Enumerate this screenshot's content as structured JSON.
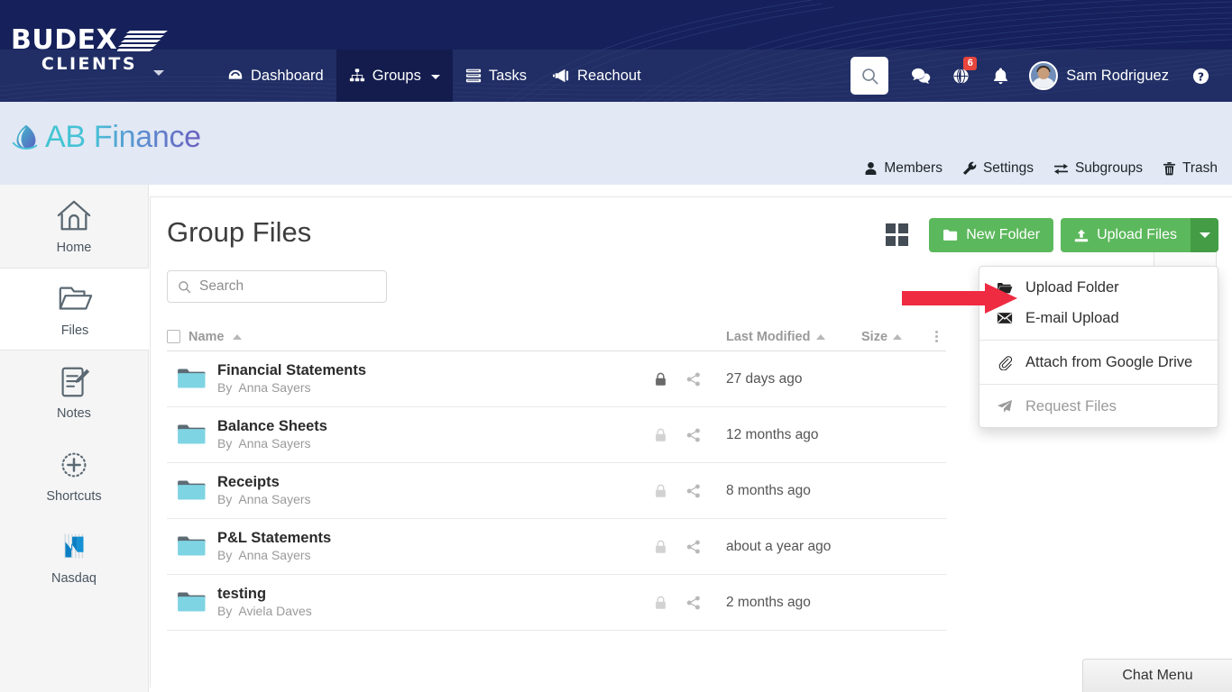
{
  "topnav": {
    "logo_primary": "BUDEX",
    "logo_secondary": "CLIENTS",
    "items": [
      {
        "label": "Dashboard",
        "icon": "dashboard-icon",
        "active": false,
        "caret": false
      },
      {
        "label": "Groups",
        "icon": "sitemap-icon",
        "active": true,
        "caret": true
      },
      {
        "label": "Tasks",
        "icon": "tasks-icon",
        "active": false,
        "caret": false
      },
      {
        "label": "Reachout",
        "icon": "bullhorn-icon",
        "active": false,
        "caret": false
      }
    ],
    "search_icon": "search-icon",
    "chat_icon": "comments-icon",
    "globe_icon": "globe-icon",
    "globe_badge": "6",
    "bell_icon": "bell-icon",
    "user_name": "Sam Rodriguez",
    "help_icon": "question-circle-icon"
  },
  "group_header": {
    "name": "AB Finance",
    "logo_icon": "ab-finance-logo-icon",
    "links": [
      {
        "label": "Members",
        "icon": "user-icon"
      },
      {
        "label": "Settings",
        "icon": "wrench-icon"
      },
      {
        "label": "Subgroups",
        "icon": "exchange-icon"
      },
      {
        "label": "Trash",
        "icon": "trash-icon"
      }
    ]
  },
  "sidebar": {
    "items": [
      {
        "label": "Home",
        "icon": "home-icon",
        "active": false
      },
      {
        "label": "Files",
        "icon": "folder-open-icon",
        "active": true
      },
      {
        "label": "Notes",
        "icon": "notes-pencil-icon",
        "active": false
      },
      {
        "label": "Shortcuts",
        "icon": "plus-circle-dashed-icon",
        "active": false
      },
      {
        "label": "Nasdaq",
        "icon": "nasdaq-icon",
        "active": false
      }
    ]
  },
  "main": {
    "title": "Group Files",
    "grid_view_icon": "grid-view-icon",
    "new_folder_label": "New Folder",
    "new_folder_icon": "folder-icon",
    "upload_files_label": "Upload Files",
    "upload_files_icon": "upload-icon",
    "upload_caret_icon": "caret-down-icon",
    "search": {
      "value": "",
      "placeholder": "Search",
      "icon": "search-icon"
    },
    "dropdown": {
      "items": [
        {
          "label": "Upload Folder",
          "icon": "folder-open-icon",
          "disabled": false,
          "highlighted": false
        },
        {
          "label": "E-mail Upload",
          "icon": "envelope-icon",
          "disabled": false,
          "highlighted": true
        },
        {
          "label": "Attach from Google Drive",
          "icon": "paperclip-icon",
          "disabled": false,
          "highlighted": false
        },
        {
          "label": "Request Files",
          "icon": "paper-plane-icon",
          "disabled": true,
          "highlighted": false
        }
      ]
    },
    "table": {
      "headers": {
        "name": "Name",
        "last_modified": "Last Modified",
        "size": "Size",
        "menu_icon": "ellipsis-vertical-icon",
        "select_all_checkbox": "select-all-checkbox"
      },
      "rows": [
        {
          "name": "Financial Statements",
          "by_prefix": "By",
          "author": "Anna Sayers",
          "last_modified": "27 days ago",
          "size": "",
          "lock_icon": "lock-icon",
          "lock_active": true,
          "share_icon": "share-icon"
        },
        {
          "name": "Balance Sheets",
          "by_prefix": "By",
          "author": "Anna Sayers",
          "last_modified": "12 months ago",
          "size": "",
          "lock_icon": "lock-icon",
          "lock_active": false,
          "share_icon": "share-icon"
        },
        {
          "name": "Receipts",
          "by_prefix": "By",
          "author": "Anna Sayers",
          "last_modified": "8 months ago",
          "size": "",
          "lock_icon": "lock-icon",
          "lock_active": false,
          "share_icon": "share-icon"
        },
        {
          "name": "P&L Statements",
          "by_prefix": "By",
          "author": "Anna Sayers",
          "last_modified": "about a year ago",
          "size": "",
          "lock_icon": "lock-icon",
          "lock_active": false,
          "share_icon": "share-icon"
        },
        {
          "name": "testing",
          "by_prefix": "By",
          "author": "Aviela Daves",
          "last_modified": "2 months ago",
          "size": "",
          "lock_icon": "lock-icon",
          "lock_active": false,
          "share_icon": "share-icon"
        }
      ]
    }
  },
  "chat": {
    "label": "Chat Menu"
  },
  "annotation": {
    "arrow_icon": "red-arrow-right-icon",
    "color": "#ef2b42"
  },
  "colors": {
    "nav_bg": "#16215b",
    "nav_active": "#131c4d",
    "group_header_bg": "#e2e8f4",
    "green": "#5cb85c",
    "green_dark": "#449d44",
    "folder_body": "#7fd4e3",
    "folder_tab": "#5c6b74",
    "badge_red": "#e8453c"
  }
}
